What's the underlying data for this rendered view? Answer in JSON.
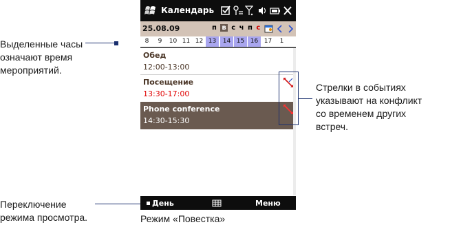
{
  "status_bar": {
    "app_title": "Календарь",
    "icons": [
      "windows-flag-icon",
      "checkbox-icon",
      "connectivity-icon",
      "signal-icon",
      "volume-icon",
      "battery-icon",
      "close-icon"
    ]
  },
  "toolbar": {
    "date": "25.08.09",
    "weekdays": [
      {
        "label": "п",
        "selected": false,
        "weekend": false
      },
      {
        "label": "в",
        "selected": true,
        "weekend": false
      },
      {
        "label": "с",
        "selected": false,
        "weekend": false
      },
      {
        "label": "ч",
        "selected": false,
        "weekend": false
      },
      {
        "label": "п",
        "selected": false,
        "weekend": false
      },
      {
        "label": "с",
        "selected": false,
        "weekend": true
      },
      {
        "label": "в",
        "selected": false,
        "weekend": true
      }
    ],
    "icons": [
      "calendar-icon",
      "prev-arrow-icon",
      "next-arrow-icon"
    ]
  },
  "hours": [
    {
      "label": "8",
      "busy": false
    },
    {
      "label": "9",
      "busy": false
    },
    {
      "label": "10",
      "busy": false
    },
    {
      "label": "11",
      "busy": false
    },
    {
      "label": "12",
      "busy": false
    },
    {
      "label": "13",
      "busy": true
    },
    {
      "label": "14",
      "busy": true
    },
    {
      "label": "15",
      "busy": true
    },
    {
      "label": "16",
      "busy": true
    },
    {
      "label": "17",
      "busy": false
    },
    {
      "label": "1",
      "busy": false
    }
  ],
  "events": [
    {
      "title": "Обед",
      "time": "12:00-13:00",
      "conflict": false,
      "selected": false
    },
    {
      "title": "Посещение",
      "time": "13:30-17:00",
      "conflict": true,
      "selected": false
    },
    {
      "title": "Phone conference",
      "time": "14:30-15:30",
      "conflict": true,
      "selected": true
    }
  ],
  "softkeys": {
    "left": "День",
    "right": "Меню"
  },
  "callouts": {
    "left_top": [
      "Выделенные часы",
      "означают время",
      "мероприятий."
    ],
    "right": [
      "Стрелки в событиях",
      "указывают на конфликт",
      "со временем других",
      "встреч."
    ],
    "left_bottom": [
      "Переключение",
      "режима просмотра."
    ]
  },
  "caption": "Режим «Повестка»",
  "colors": {
    "status_bar": "#0d0d0d",
    "toolbar": "#d3c3b7",
    "busy_hour": "#a9a6ef",
    "selected_event": "#6a5a50",
    "event_title": "#4a3526",
    "conflict_time": "#e00000",
    "leader_line": "#1a2f6e"
  }
}
